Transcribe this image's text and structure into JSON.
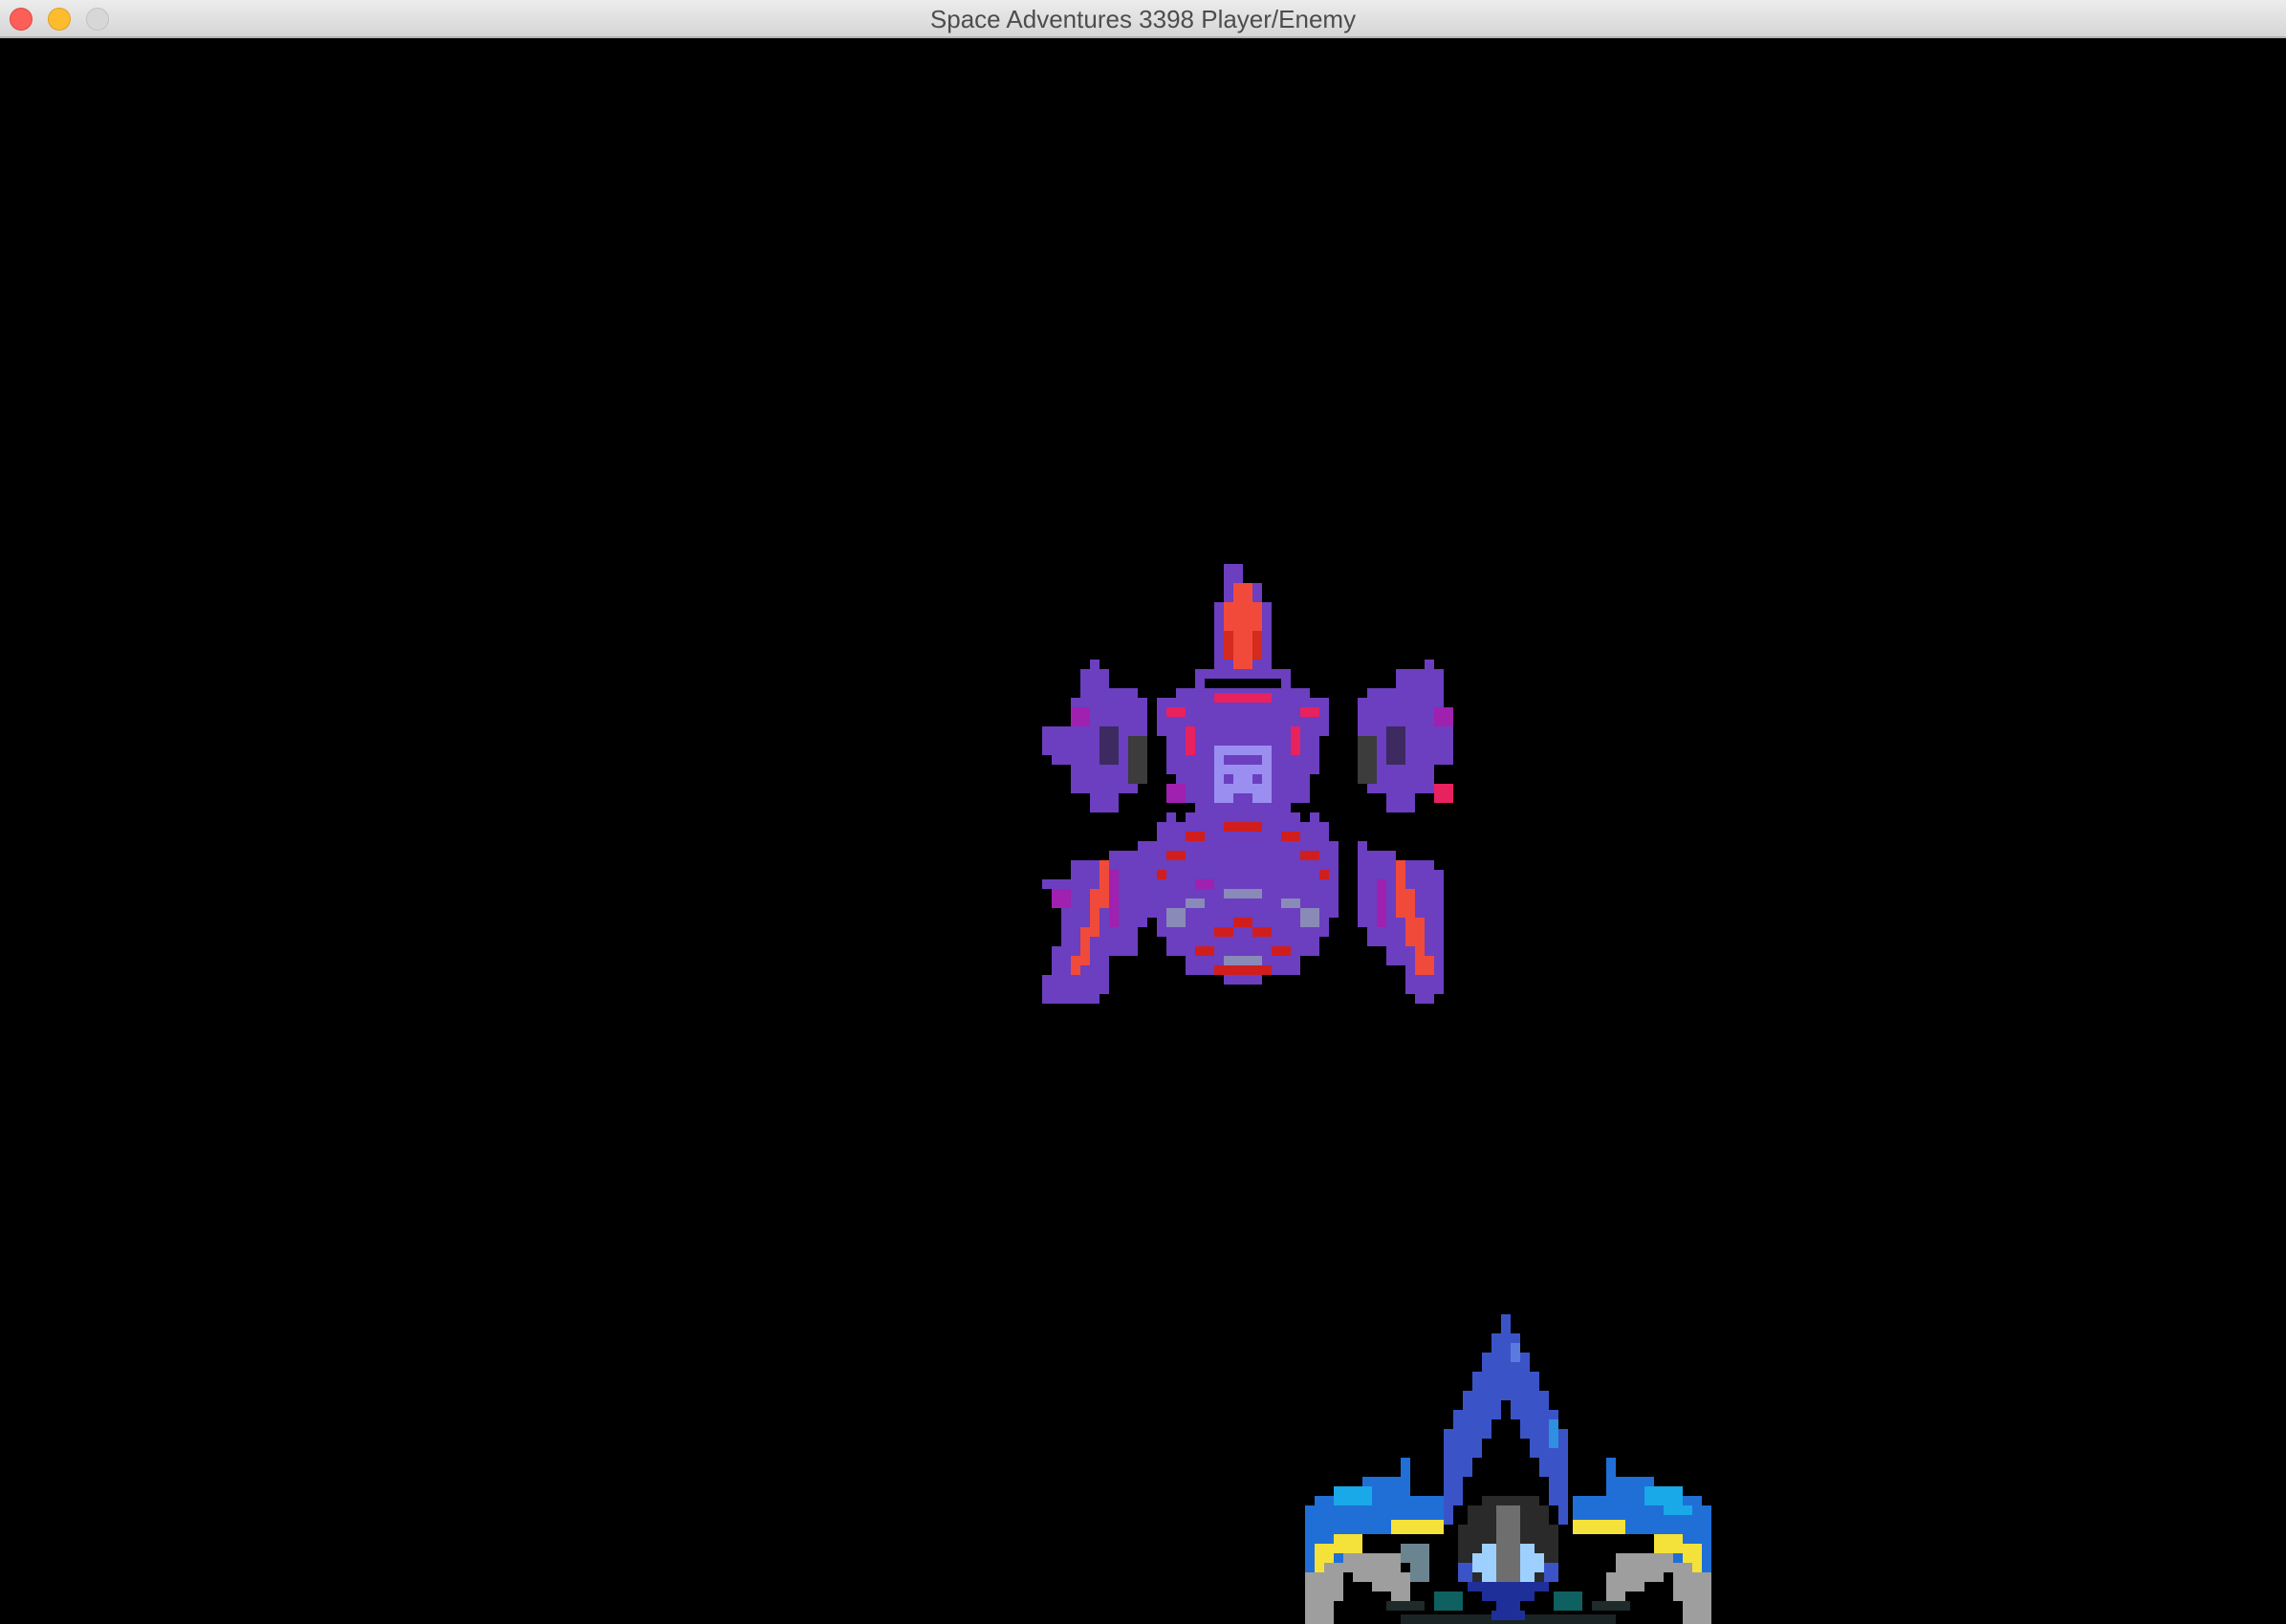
{
  "window": {
    "title": "Space Adventures 3398 Player/Enemy",
    "buttons": {
      "close": "close-window",
      "minimize": "minimize-window",
      "zoom": "zoom-window"
    }
  },
  "game": {
    "background_color": "#000000",
    "enemy": {
      "icon": "enemy-ship-sprite",
      "colors": {
        "hull": "#6b3fbf",
        "hull_dark": "#5a2fa0",
        "cockpit": "#f24a3a",
        "accent_pink": "#e8215f",
        "accent_magenta": "#a020b0",
        "core": "#9a8ff0",
        "stripe_red": "#d01e1e",
        "metal": "#8a8ab8"
      }
    },
    "player": {
      "icon": "player-ship-sprite",
      "colors": {
        "hull_blue": "#3a54c8",
        "wing_cyan": "#19a8e8",
        "wing_blue": "#1f6fd6",
        "stripe_yellow": "#f4e23a",
        "metal_gray": "#9e9e9e",
        "dark_gray": "#3c3c3c",
        "cockpit_light": "#9dd0ff",
        "cockpit_dark": "#2a3fb0",
        "engine_teal": "#0f6060"
      }
    }
  }
}
